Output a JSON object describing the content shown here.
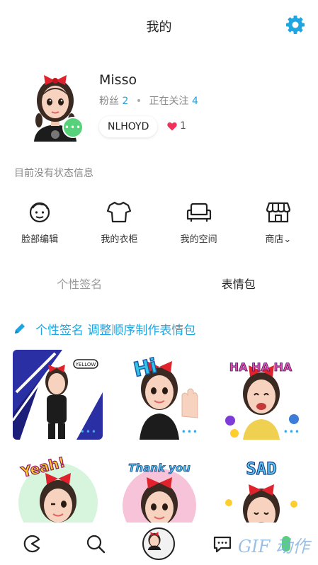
{
  "header": {
    "title": "我的",
    "settings_icon": "gear-icon",
    "accent": "#1fa6e0"
  },
  "profile": {
    "username": "Misso",
    "fans_label": "粉丝",
    "fans_count": "2",
    "following_label": "正在关注",
    "following_count": "4",
    "dot": "•",
    "code": "NLHOYD",
    "likes_count": "1",
    "badge_glyph": "•••"
  },
  "status": {
    "text": "目前没有状态信息"
  },
  "menu": [
    {
      "label": "脸部编辑",
      "icon": "face-icon"
    },
    {
      "label": "我的衣柜",
      "icon": "shirt-icon"
    },
    {
      "label": "我的空间",
      "icon": "sofa-icon"
    },
    {
      "label": "商店⌄",
      "icon": "store-icon"
    }
  ],
  "tabs": [
    {
      "label": "个性签名",
      "active": false
    },
    {
      "label": "表情包",
      "active": true
    }
  ],
  "banner": {
    "text": "个性签名 调整顺序制作表情包",
    "icon": "pencil-icon"
  },
  "stickers": [
    {
      "caption": "YELLOW",
      "more": "•••"
    },
    {
      "caption": "Hi",
      "more": "•••"
    },
    {
      "caption": "HA HA HA",
      "more": "•••"
    },
    {
      "caption": "Yeah!",
      "more": ""
    },
    {
      "caption": "Thank you",
      "more": ""
    },
    {
      "caption": "SAD",
      "more": ""
    }
  ],
  "bottom_nav": [
    {
      "icon": "pacman-icon"
    },
    {
      "icon": "search-icon"
    },
    {
      "icon": "avatar"
    },
    {
      "icon": "chat-icon"
    },
    {
      "icon": "gif-icon"
    }
  ],
  "watermark": "GIF 动作"
}
